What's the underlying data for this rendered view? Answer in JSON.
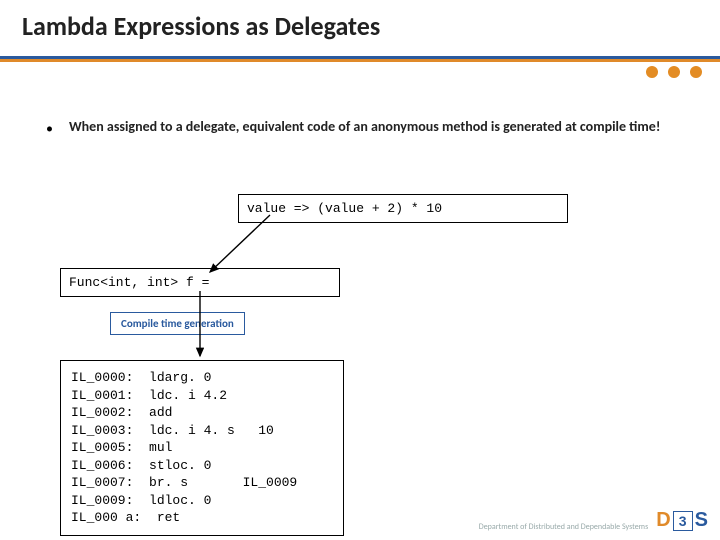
{
  "title": "Lambda Expressions as Delegates",
  "bullet": "When assigned to a delegate, equivalent code of an anonymous method is generated at compile time!",
  "code": {
    "lambda": "value => (value + 2) * 10",
    "delegate": "Func<int, int> f =",
    "il": "IL_0000:  ldarg. 0\nIL_0001:  ldc. i 4.2\nIL_0002:  add\nIL_0003:  ldc. i 4. s   10\nIL_0005:  mul\nIL_0006:  stloc. 0\nIL_0007:  br. s       IL_0009\nIL_0009:  ldloc. 0\nIL_000 a:  ret"
  },
  "label": "Compile time generation",
  "footer": {
    "dept": "Department of\nDistributed and\nDependable\nSystems",
    "logo_d": "D",
    "logo_3": "3",
    "logo_s": "S"
  }
}
